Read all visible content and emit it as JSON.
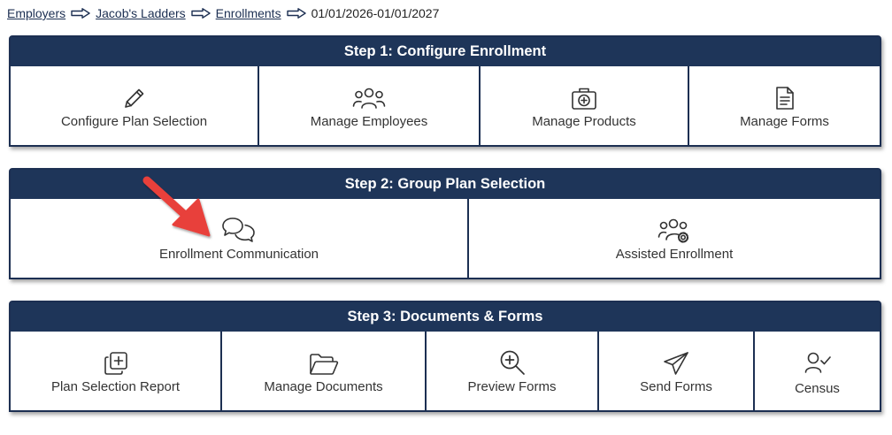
{
  "breadcrumb": {
    "items": [
      "Employers",
      "Jacob's Ladders",
      "Enrollments"
    ],
    "current": "01/01/2026-01/01/2027"
  },
  "step1": {
    "title": "Step 1: Configure Enrollment",
    "tiles": [
      {
        "label": "Configure Plan Selection",
        "icon": "pencil-icon"
      },
      {
        "label": "Manage Employees",
        "icon": "users-icon"
      },
      {
        "label": "Manage Products",
        "icon": "medical-kit-icon"
      },
      {
        "label": "Manage Forms",
        "icon": "document-icon"
      }
    ]
  },
  "step2": {
    "title": "Step 2: Group Plan Selection",
    "tiles": [
      {
        "label": "Enrollment Communication",
        "icon": "chat-bubbles-icon"
      },
      {
        "label": "Assisted Enrollment",
        "icon": "users-gear-icon"
      }
    ]
  },
  "step3": {
    "title": "Step 3: Documents & Forms",
    "tiles": [
      {
        "label": "Plan Selection Report",
        "icon": "copy-plus-icon"
      },
      {
        "label": "Manage Documents",
        "icon": "folder-open-icon"
      },
      {
        "label": "Preview Forms",
        "icon": "zoom-in-icon"
      },
      {
        "label": "Send Forms",
        "icon": "paper-plane-icon"
      },
      {
        "label": "Census",
        "icon": "user-check-icon"
      }
    ]
  },
  "colors": {
    "header_bg": "#1e3559",
    "border": "#1c2f52",
    "annotation_arrow": "#e8413b"
  }
}
